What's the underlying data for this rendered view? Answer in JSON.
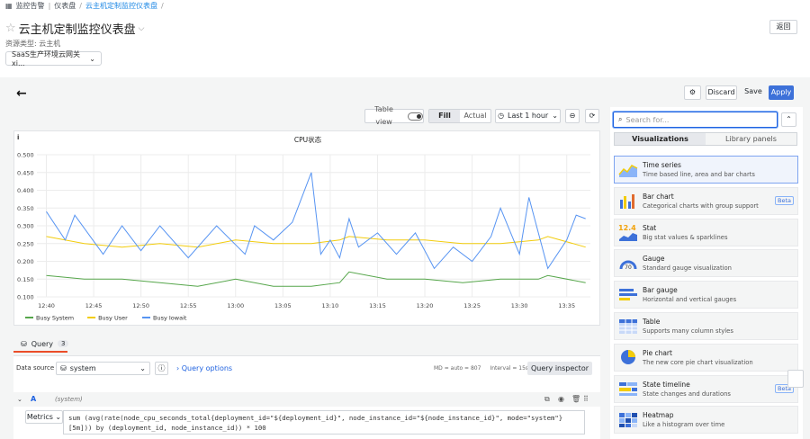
{
  "breadcrumb": {
    "items": [
      "监控告警",
      "仪表盘",
      "云主机定制监控仪表盘"
    ]
  },
  "page": {
    "title": "云主机定制监控仪表盘",
    "resource_type": "资源类型: 云主机",
    "env_value": "SaaS生产环境云网关xi...",
    "back_label": "返回"
  },
  "toolbar": {
    "discard": "Discard",
    "save": "Save",
    "apply": "Apply"
  },
  "panel_toolbar": {
    "table_view": "Table view",
    "fill": "Fill",
    "actual": "Actual",
    "time_range": "Last 1 hour"
  },
  "chart_data": {
    "type": "line",
    "title": "CPU状态",
    "y_ticks": [
      "0.500",
      "0.450",
      "0.400",
      "0.350",
      "0.300",
      "0.250",
      "0.200",
      "0.150",
      "0.100"
    ],
    "ylim": [
      0.1,
      0.5
    ],
    "x_ticks": [
      "12:40",
      "12:45",
      "12:50",
      "12:55",
      "13:00",
      "13:05",
      "13:10",
      "13:15",
      "13:20",
      "13:25",
      "13:30",
      "13:35"
    ],
    "xlim_minutes": [
      -1,
      57.5
    ],
    "grid": true,
    "legend_placement": "bottom-left",
    "series": [
      {
        "name": "Busy System",
        "color": "#56a64b",
        "x": [
          0,
          4,
          8,
          12,
          16,
          20,
          24,
          28,
          31,
          32,
          36,
          40,
          44,
          48,
          52,
          53,
          57
        ],
        "values": [
          0.16,
          0.15,
          0.15,
          0.14,
          0.13,
          0.15,
          0.13,
          0.13,
          0.14,
          0.17,
          0.15,
          0.15,
          0.14,
          0.15,
          0.15,
          0.16,
          0.14
        ]
      },
      {
        "name": "Busy User",
        "color": "#f2cc0c",
        "x": [
          0,
          4,
          8,
          12,
          16,
          20,
          24,
          28,
          31,
          32,
          36,
          40,
          44,
          48,
          52,
          53,
          57
        ],
        "values": [
          0.27,
          0.25,
          0.24,
          0.25,
          0.24,
          0.26,
          0.25,
          0.25,
          0.26,
          0.27,
          0.26,
          0.26,
          0.25,
          0.25,
          0.26,
          0.27,
          0.24
        ]
      },
      {
        "name": "Busy Iowait",
        "color": "#5794f2",
        "x": [
          0,
          2,
          3,
          6,
          8,
          10,
          12,
          15,
          18,
          21,
          22,
          24,
          26,
          28,
          29,
          30,
          31,
          32,
          33,
          35,
          37,
          39,
          41,
          43,
          45,
          47,
          48,
          50,
          51,
          53,
          55,
          56,
          57
        ],
        "values": [
          0.34,
          0.26,
          0.33,
          0.22,
          0.3,
          0.23,
          0.3,
          0.21,
          0.3,
          0.22,
          0.3,
          0.26,
          0.31,
          0.45,
          0.22,
          0.26,
          0.21,
          0.32,
          0.24,
          0.28,
          0.22,
          0.28,
          0.18,
          0.24,
          0.2,
          0.27,
          0.35,
          0.22,
          0.38,
          0.18,
          0.26,
          0.33,
          0.32
        ]
      }
    ]
  },
  "query": {
    "tab_label": "Query",
    "count": "3",
    "datasource_label": "Data source",
    "datasource": "system",
    "options_label": "Query options",
    "md": "MD = auto = 807",
    "interval": "Interval = 15s",
    "inspector": "Query inspector",
    "ref_id": "A",
    "ref_desc": "(system)",
    "metrics_label": "Metrics",
    "expr_line1": "sum (avg(rate(node_cpu_seconds_total{deployment_id=\"${deployment_id}\", node_instance_id=\"${node_instance_id}\", mode=\"system\"}",
    "expr_line2": "[5m])) by (deployment_id, node_instance_id)) * 100"
  },
  "viz": {
    "search_placeholder": "Search for...",
    "tab_viz": "Visualizations",
    "tab_lib": "Library panels",
    "items": [
      {
        "name": "Time series",
        "desc": "Time based line, area and bar charts",
        "icon": "time-series-icon"
      },
      {
        "name": "Bar chart",
        "desc": "Categorical charts with group support",
        "icon": "bar-chart-icon",
        "badge": "Beta"
      },
      {
        "name": "Stat",
        "desc": "Big stat values & sparklines",
        "icon": "stat-icon",
        "glyph": "12.4"
      },
      {
        "name": "Gauge",
        "desc": "Standard gauge visualization",
        "icon": "gauge-icon",
        "glyph": "70"
      },
      {
        "name": "Bar gauge",
        "desc": "Horizontal and vertical gauges",
        "icon": "bar-gauge-icon"
      },
      {
        "name": "Table",
        "desc": "Supports many column styles",
        "icon": "table-icon"
      },
      {
        "name": "Pie chart",
        "desc": "The new core pie chart visualization",
        "icon": "pie-chart-icon"
      },
      {
        "name": "State timeline",
        "desc": "State changes and durations",
        "icon": "state-timeline-icon",
        "badge": "Beta"
      },
      {
        "name": "Heatmap",
        "desc": "Like a histogram over time",
        "icon": "heatmap-icon"
      }
    ]
  }
}
